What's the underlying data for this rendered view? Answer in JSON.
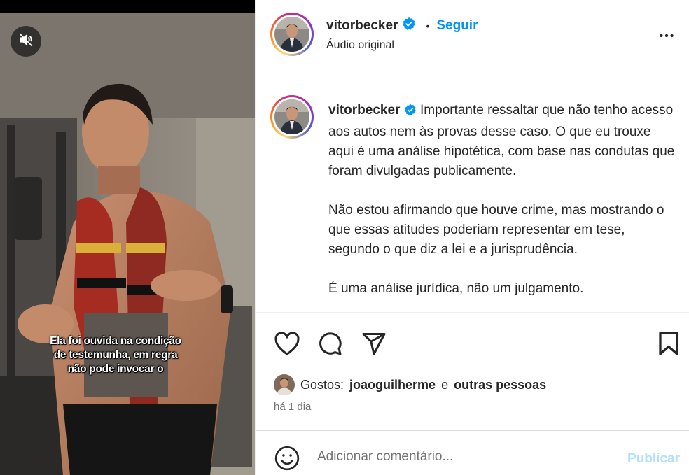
{
  "video": {
    "subtitle": "Ela foi ouvida na condição\nde testemunha, em regra\nnão pode invocar o"
  },
  "header": {
    "username": "vitorbecker",
    "separator": "•",
    "follow_label": "Seguir",
    "audio_label": "Áudio original"
  },
  "caption": {
    "username": "vitorbecker",
    "paragraphs": [
      "Importante ressaltar que não tenho acesso aos autos nem às provas desse caso. O que eu trouxe aqui é uma análise hipotética, com base nas condutas que foram divulgadas publicamente.",
      "Não estou afirmando que houve crime, mas mostrando o que essas atitudes poderiam representar em tese, segundo o que diz a lei e a jurisprudência.",
      "É uma análise jurídica, não um julgamento."
    ]
  },
  "likes": {
    "prefix": "Gostos:",
    "user": "joaoguilherme",
    "connector": "e",
    "others": "outras pessoas"
  },
  "time": "há 1 dia",
  "comment": {
    "placeholder": "Adicionar comentário...",
    "publish_label": "Publicar"
  },
  "colors": {
    "accent": "#0095f6",
    "publish_disabled": "#b2dffc",
    "verified": "#0095f6",
    "muted_text": "#737373"
  },
  "icons": {
    "mute": "speaker-muted-icon",
    "more": "more-horizontal-icon",
    "verified": "verified-badge-icon",
    "like": "heart-icon",
    "comment": "comment-bubble-icon",
    "share": "paper-plane-icon",
    "save": "bookmark-icon",
    "emoji": "smiley-icon"
  }
}
